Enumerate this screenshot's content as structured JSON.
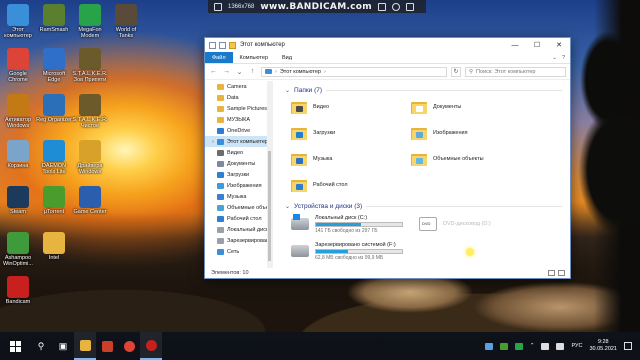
{
  "recorder": {
    "watermark": "www.BANDICAM.com",
    "resolution": "1366x768"
  },
  "desktop": {
    "icons": [
      {
        "label": "Этот компьютер",
        "icon": "this-pc-icon",
        "color": "#3a8fd9"
      },
      {
        "label": "RamSmash",
        "icon": "ramsmash-icon",
        "color": "#5a7f2e"
      },
      {
        "label": "MegaFon Modem",
        "icon": "megafon-icon",
        "color": "#29a34a"
      },
      {
        "label": "World of Tanks",
        "icon": "world-of-tanks-icon",
        "color": "#5a4a3a"
      },
      {
        "label": "Google Chrome",
        "icon": "chrome-icon",
        "color": "#db4437"
      },
      {
        "label": "Microsoft Edge",
        "icon": "edge-icon",
        "color": "#2f6fc9"
      },
      {
        "label": "S.T.A.L.K.E.R. Зов Припяти",
        "icon": "stalker-icon",
        "color": "#6b5b2b"
      },
      {
        "label": "Активатор Windows",
        "icon": "activator-icon",
        "color": "#c47a14"
      },
      {
        "label": "Reg Organizer",
        "icon": "reg-organizer-icon",
        "color": "#2a6fb8"
      },
      {
        "label": "S.T.A.L.K.E.R. Чистое",
        "icon": "stalker-cs-icon",
        "color": "#6d5a2a"
      },
      {
        "label": "Корзина",
        "icon": "recycle-bin-icon",
        "color": "#7aa4c9"
      },
      {
        "label": "DAEMON Tools Lite",
        "icon": "daemon-tools-icon",
        "color": "#1f8dd6"
      },
      {
        "label": "Драйвера Windows",
        "icon": "drivers-icon",
        "color": "#d8a12a"
      },
      {
        "label": "Steam",
        "icon": "steam-icon",
        "color": "#1b3a5c"
      },
      {
        "label": "μTorrent",
        "icon": "utorrent-icon",
        "color": "#4a9c2d"
      },
      {
        "label": "Game Center",
        "icon": "game-center-icon",
        "color": "#2b5fae"
      },
      {
        "label": "Ashampoo WinOptimi...",
        "icon": "ashampoo-icon",
        "color": "#3e9a3a"
      },
      {
        "label": "Intel",
        "icon": "intel-folder-icon",
        "color": "#e8b440"
      },
      {
        "label": "Bandicam",
        "icon": "bandicam-icon",
        "color": "#c81f1f"
      }
    ]
  },
  "explorer": {
    "title": "Этот компьютер",
    "ribbon": {
      "file": "Файл",
      "computer": "Компьютер",
      "view": "Вид"
    },
    "address": {
      "path": "Этот компьютер",
      "search_placeholder": "Поиск: Этот компьютер"
    },
    "nav": [
      {
        "label": "Camera",
        "color": "#e8b440"
      },
      {
        "label": "Data",
        "color": "#e8b440"
      },
      {
        "label": "Sample Pictures",
        "color": "#e8b440"
      },
      {
        "label": "МУЗЫКА",
        "color": "#e8b440"
      },
      {
        "label": "OneDrive",
        "color": "#2b7cd3"
      },
      {
        "label": "Этот компьютер",
        "color": "#3a8fd9",
        "selected": true
      },
      {
        "label": "Видео",
        "color": "#6c6c6c"
      },
      {
        "label": "Документы",
        "color": "#7c8aa0"
      },
      {
        "label": "Загрузки",
        "color": "#2f7fd1"
      },
      {
        "label": "Изображения",
        "color": "#3e9bd7"
      },
      {
        "label": "Музыка",
        "color": "#3b7fd0"
      },
      {
        "label": "Объемные объекты",
        "color": "#4da3d8"
      },
      {
        "label": "Рабочий стол",
        "color": "#2e7fcf"
      },
      {
        "label": "Локальный диск",
        "color": "#9aa0a8"
      },
      {
        "label": "Зарезервировано",
        "color": "#9aa0a8"
      },
      {
        "label": "Сеть",
        "color": "#3a8fd9"
      }
    ],
    "folders_header": "Папки (7)",
    "folders": [
      {
        "label": "Видео",
        "badge": "#4b4b4b"
      },
      {
        "label": "Документы",
        "badge": "#ffffff"
      },
      {
        "label": "Загрузки",
        "badge": "#1f7ed6"
      },
      {
        "label": "Изображения",
        "badge": "#5ea9dd"
      },
      {
        "label": "Музыка",
        "badge": "#2a6fc9"
      },
      {
        "label": "Объемные объекты",
        "badge": "#61b8e6"
      },
      {
        "label": "Рабочий стол",
        "badge": "#2c7fd0"
      }
    ],
    "drives_header": "Устройства и диски (3)",
    "drives": [
      {
        "name": "Локальный диск (C:)",
        "free": "141 ГБ свободно из 297 ГБ",
        "used_fraction": 0.52,
        "kind": "win10"
      },
      {
        "name": "DVD-дисковод (D:)",
        "free": "",
        "used_fraction": null,
        "kind": "dvd"
      },
      {
        "name": "Зарезервировано системой (F:)",
        "free": "62,8 МБ свободно из 99,9 МБ",
        "used_fraction": 0.37,
        "kind": "disk"
      }
    ],
    "status": "Элементов: 10"
  },
  "taskbar": {
    "apps": [
      {
        "icon": "search-icon"
      },
      {
        "icon": "task-view-icon"
      },
      {
        "icon": "file-explorer-icon",
        "color": "#e8b440",
        "active": true
      },
      {
        "icon": "store-icon",
        "color": "#ca3f2b"
      },
      {
        "icon": "chrome-icon",
        "color": "#db4437"
      },
      {
        "icon": "bandicam-icon",
        "color": "#c81f1f",
        "active": true
      }
    ],
    "language": "РУС",
    "time": "9:28",
    "date": "30.05.2021"
  }
}
